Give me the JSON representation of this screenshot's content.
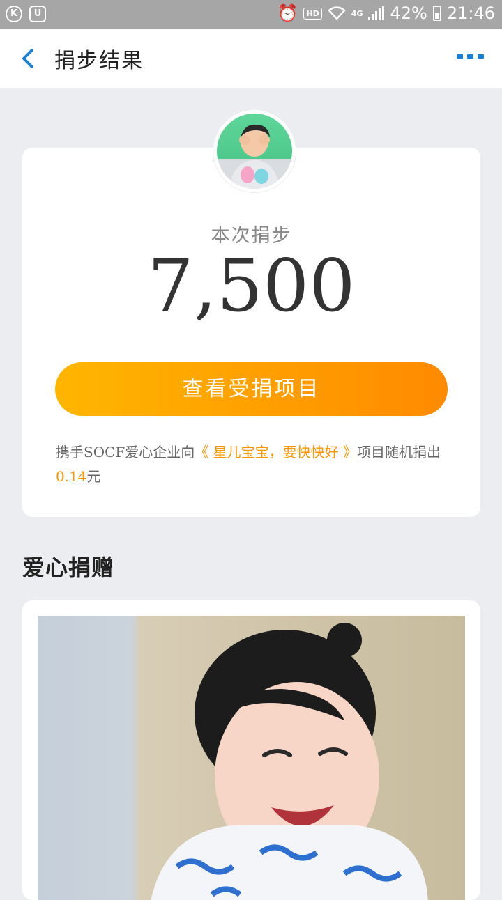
{
  "status_bar": {
    "battery": "42%",
    "time": "21:46",
    "network": "4G",
    "hd": "HD"
  },
  "nav": {
    "title": "捐步结果"
  },
  "result": {
    "label": "本次捐步",
    "steps": "7,500",
    "button": "查看受捐项目",
    "desc_prefix": "携手SOCF爱心企业向",
    "project": "《 星儿宝宝，要快快好 》",
    "desc_mid": "项目随机捐出",
    "amount": "0.14",
    "unit": "元"
  },
  "section": {
    "title": "爱心捐赠"
  },
  "colors": {
    "accent_orange": "#ff9400",
    "nav_blue": "#1a7fd6",
    "button_gradient_start": "#ffb600",
    "button_gradient_end": "#ff8a00"
  }
}
